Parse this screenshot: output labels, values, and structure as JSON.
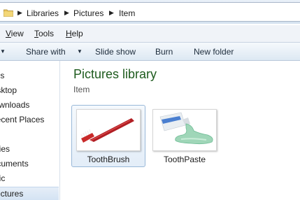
{
  "address": {
    "crumbs": [
      "Libraries",
      "Pictures",
      "Item"
    ]
  },
  "menu": {
    "items": [
      {
        "label_pre": "",
        "accel": "V",
        "label_post": "iew"
      },
      {
        "label_pre": "",
        "accel": "T",
        "label_post": "ools"
      },
      {
        "label_pre": "",
        "accel": "H",
        "label_post": "elp"
      }
    ]
  },
  "toolbar": {
    "share_with": "Share with",
    "slide_show": "Slide show",
    "burn": "Burn",
    "new_folder": "New folder"
  },
  "sidebar": {
    "items": [
      "Favorites",
      "Desktop",
      "Downloads",
      "Recent Places",
      "Libraries",
      "Documents",
      "Music",
      "Pictures"
    ]
  },
  "main": {
    "title": "Pictures library",
    "subtitle": "Item",
    "files": [
      {
        "name": "ToothBrush",
        "icon": "toothbrush-thumbnail",
        "selected": true
      },
      {
        "name": "ToothPaste",
        "icon": "toothpaste-thumbnail",
        "selected": false
      }
    ]
  },
  "colors": {
    "library_title": "#1e5b1e",
    "selection_border": "#99b8d8"
  }
}
